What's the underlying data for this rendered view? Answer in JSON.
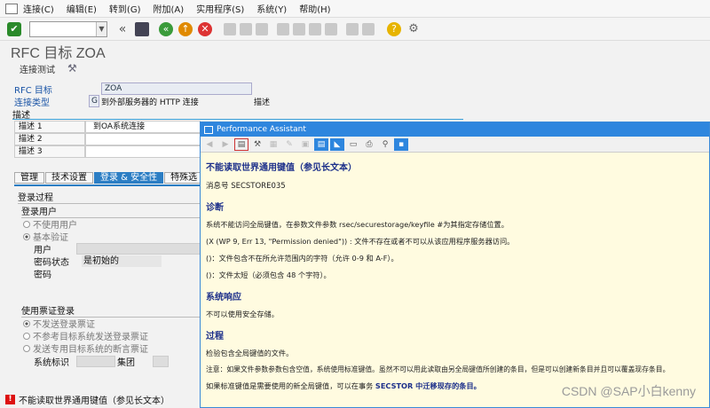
{
  "menu": [
    "连接(C)",
    "编辑(E)",
    "转到(G)",
    "附加(A)",
    "实用程序(S)",
    "系统(Y)",
    "帮助(H)"
  ],
  "page_title": "RFC 目标 ZOA",
  "subbar": {
    "test_label": "连接测试"
  },
  "form": {
    "rfc_label": "RFC 目标",
    "rfc_value": "ZOA",
    "conn_type_label": "连接类型",
    "conn_type_code": "G",
    "conn_type_value": "到外部服务器的 HTTP 连接",
    "desc_short": "描述"
  },
  "desc": {
    "header": "描述",
    "rows": [
      {
        "label": "描述 1",
        "value": "到OA系统连接"
      },
      {
        "label": "描述 2",
        "value": ""
      },
      {
        "label": "描述 3",
        "value": ""
      }
    ]
  },
  "tabs": [
    "管理",
    "技术设置",
    "登录 & 安全性",
    "特殊选"
  ],
  "logon": {
    "section": "登录过程",
    "group": "登录用户",
    "radio_no_user": "不使用用户",
    "radio_basic": "基本验证",
    "user_label": "用户",
    "pwd_status_label": "密码状态",
    "pwd_status_value": "是初始的",
    "pwd_label": "密码"
  },
  "ticket": {
    "section": "使用票证登录",
    "opt1": "不发送登录票证",
    "opt2": "不参考目标系统发送登录票证",
    "opt3": "发送专用目标系统的断言票证",
    "sysid_label": "系统标识",
    "client_label": "集团"
  },
  "status": {
    "text": "不能读取世界通用键值（参见长文本）"
  },
  "pa": {
    "title": "Performance Assistant",
    "heading": "不能读取世界通用键值（参见长文本）",
    "msgno": "消息号 SECSTORE035",
    "diag_h": "诊断",
    "diag_p1": "系统不能访问全局键值，在参数文件参数 rsec/securestorage/keyfile #为其指定存储位置。",
    "diag_p2": "(X (WP 9, Err 13, \"Permission denied\")) : 文件不存在或者不可以从该应用程序服务器访问。",
    "diag_p3": "()：文件包含不在所允许范围内的字符（允许 0-9 和 A-F）。",
    "diag_p4": "()：文件太短（必须包含 48 个字符）。",
    "resp_h": "系统响应",
    "resp_p": "不可以使用安全存储。",
    "proc_h": "过程",
    "proc_p1": "检验包含全局键值的文件。",
    "proc_p2": "注意：如果文件参数参数包含空值，系统使用标准键值。虽然不可以用此读取由另全局键值所创建的条目，但是可以创建新条目并且可以覆盖现存条目。",
    "proc_p3_prefix": "如果标准键值是需要使用的新全局键值，可以在事务 ",
    "proc_p3_link": "SECSTOR 中迁移现存的条目。"
  },
  "watermark": "CSDN @SAP小白kenny"
}
